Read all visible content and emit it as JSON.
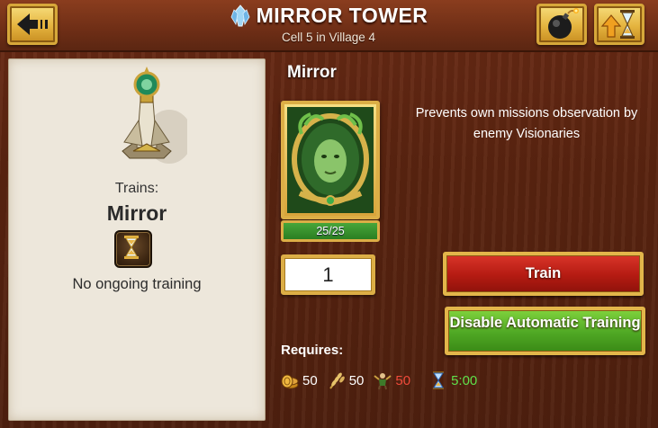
{
  "header": {
    "title": "MIRROR TOWER",
    "subtitle": "Cell 5 in Village 4"
  },
  "left_panel": {
    "trains_label": "Trains:",
    "unit_name": "Mirror",
    "status": "No ongoing training"
  },
  "unit": {
    "name": "Mirror",
    "count": "25/25",
    "description": "Prevents own missions observation by enemy Visionaries",
    "quantity": "1"
  },
  "actions": {
    "train_label": "Train",
    "auto_label": "Disable Automatic Training"
  },
  "requirements": {
    "label": "Requires:",
    "gold": "50",
    "food": "50",
    "worker": "50",
    "time": "5:00"
  },
  "colors": {
    "train_button": "#b41b12",
    "auto_button": "#4fa824",
    "gold_border": "#dcae46",
    "worker_value": "#f04a3a",
    "time_value": "#5fe04a"
  },
  "icons": {
    "back": "back-arrow-icon",
    "bomb": "bomb-icon",
    "speedup": "upgrade-hourglass-icon",
    "crystal": "crystal-icon",
    "hourglass": "hourglass-icon",
    "gold": "gold-coins-icon",
    "food": "wheat-icon",
    "worker": "worker-icon",
    "time": "hourglass-icon"
  }
}
